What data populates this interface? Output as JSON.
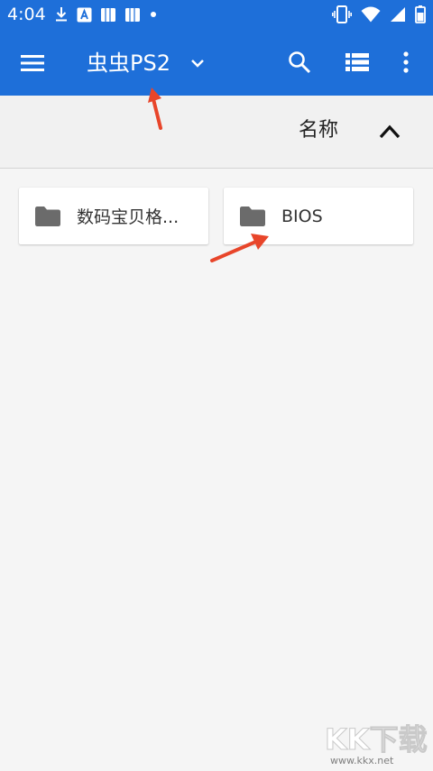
{
  "status_bar": {
    "time": "4:04",
    "left_icons": [
      "download-icon",
      "a-badge-icon",
      "notebook-icon",
      "notebook-icon",
      "dot-icon"
    ],
    "right_icons": [
      "vibrate-icon",
      "wifi-icon",
      "cell-signal-icon",
      "battery-icon"
    ]
  },
  "toolbar": {
    "title": "虫虫PS2",
    "menu_icon": "hamburger-menu-icon",
    "dropdown_icon": "chevron-down-icon",
    "search_icon": "search-icon",
    "view_icon": "list-view-icon",
    "more_icon": "more-vert-icon"
  },
  "sort": {
    "label": "名称",
    "direction_icon": "chevron-up-icon"
  },
  "folders": [
    {
      "name": "数码宝贝格...",
      "icon": "folder-icon"
    },
    {
      "name": "BIOS",
      "icon": "folder-icon"
    }
  ],
  "watermark": {
    "text": "KK下载",
    "url": "www.kkx.net"
  },
  "colors": {
    "appbar": "#1e6fd9",
    "sortbar": "#f1f1f1",
    "background": "#f5f5f5",
    "folder_icon": "#6b6b6b",
    "annotation_arrow": "#e8452a"
  }
}
